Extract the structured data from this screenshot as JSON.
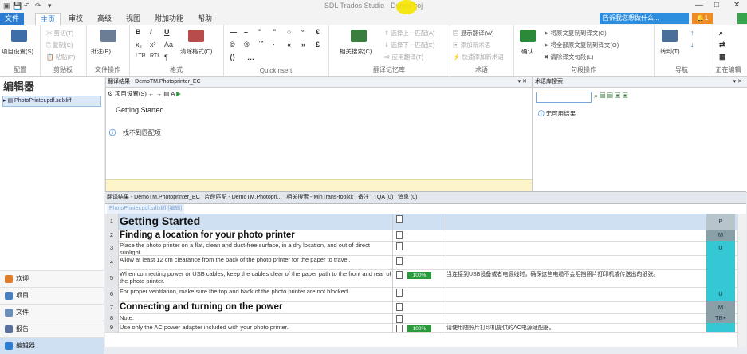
{
  "window": {
    "title": "SDL Trados Studio - DemoProj",
    "minimize": "—",
    "maximize": "□",
    "close": "✕"
  },
  "tabs": [
    "文件",
    "主页",
    "审校",
    "高级",
    "视图",
    "附加功能",
    "帮助"
  ],
  "help_search": "告诉我您想做什么...",
  "notification_count": "1",
  "ribbon": {
    "groups": [
      {
        "label": "配置",
        "items": [
          "项目设置(S)"
        ]
      },
      {
        "label": "剪贴板",
        "items": [
          "剪切(T)",
          "复制(C)",
          "粘贴(P)"
        ]
      },
      {
        "label": "文件操作",
        "items": [
          "批注(B)"
        ]
      },
      {
        "label": "格式",
        "items": [
          "B",
          "I",
          "U",
          "清除格式(C)"
        ]
      },
      {
        "label": "QuickInsert",
        "items": []
      },
      {
        "label": "翻译记忆库",
        "items": [
          "相关搜索(C)",
          "选择上一匹配(A)",
          "选择下一匹配(E)",
          "应用翻译(T)"
        ]
      },
      {
        "label": "术语",
        "items": [
          "显示翻译(W)",
          "添加新术语",
          "快速添加新术语"
        ]
      },
      {
        "label": "句段操作",
        "items": [
          "确认",
          "将原文复制到译文(C)",
          "将全部原文复制到译文(O)",
          "清除译文句段(L)"
        ]
      },
      {
        "label": "导航",
        "items": [
          "转到(T)"
        ]
      },
      {
        "label": "正在编辑",
        "items": []
      }
    ]
  },
  "left_panel": {
    "header": "编辑器",
    "file": "PhotoPrinter.pdf.sdlxliff",
    "nav": [
      "欢迎",
      "项目",
      "文件",
      "报告",
      "编辑器"
    ]
  },
  "tm_pane": {
    "header": "翻译结果 - DemoTM.Photoprinter_EC",
    "toolbar_label": "项目设置(S)",
    "source_text": "Getting Started",
    "no_match": "找不到匹配项"
  },
  "term_pane": {
    "header": "术语库搜索",
    "no_results": "无可用结果"
  },
  "bottom_tabs": [
    "翻译结果 - DemoTM.Photoprinter_EC",
    "片段匹配 - DemoTM.Photopri...",
    "相关搜索 - MinTrans-toolkit",
    "备注",
    "TQA (0)",
    "消息 (0)"
  ],
  "doc_tab": "PhotoPrinter.pdf.sdlxliff [编辑]",
  "segments": [
    {
      "n": "1",
      "style": "h1",
      "source": "Getting Started",
      "pct": "",
      "target": "",
      "flag": "P",
      "sel": true
    },
    {
      "n": "2",
      "style": "h2",
      "source": "Finding a location for your photo printer",
      "pct": "",
      "target": "",
      "flag": "M"
    },
    {
      "n": "3",
      "style": "p",
      "source": "Place the photo printer on a flat, clean and dust-free surface, in a dry location, and out of direct sunlight.",
      "pct": "",
      "target": "",
      "flag": "U"
    },
    {
      "n": "4",
      "style": "p",
      "source": "Allow at least 12 cm clearance from the back of the photo printer for the paper to travel.",
      "pct": "",
      "target": "",
      "flag": ""
    },
    {
      "n": "5",
      "style": "p",
      "source": "When connecting power or USB cables, keep the cables clear of the paper path to the front and rear of the photo printer.",
      "pct": "100%",
      "target": "当连接到USB设备或者电源线时，确保这些电缆不会阻挡照片打印机或传送出的纸张。",
      "flag": ""
    },
    {
      "n": "6",
      "style": "p",
      "source": "For proper ventilation, make sure the top and back of the photo printer are not blocked.",
      "pct": "",
      "target": "",
      "flag": "U"
    },
    {
      "n": "7",
      "style": "h2",
      "source": "Connecting and turning on the power",
      "pct": "",
      "target": "",
      "flag": "M"
    },
    {
      "n": "8",
      "style": "p",
      "source": "Note:",
      "pct": "",
      "target": "",
      "flag": "TB+"
    },
    {
      "n": "9",
      "style": "p",
      "source": "Use only the AC power adapter included with your photo printer.",
      "pct": "100%",
      "target": "请使用随照片打印机提供的AC电源适配器。",
      "flag": ""
    }
  ],
  "colors": {
    "accent": "#2b7cd3",
    "match_green": "#2a9a3c",
    "flag_cyan": "#35c7d4",
    "flag_gray": "#8aa0a8"
  }
}
